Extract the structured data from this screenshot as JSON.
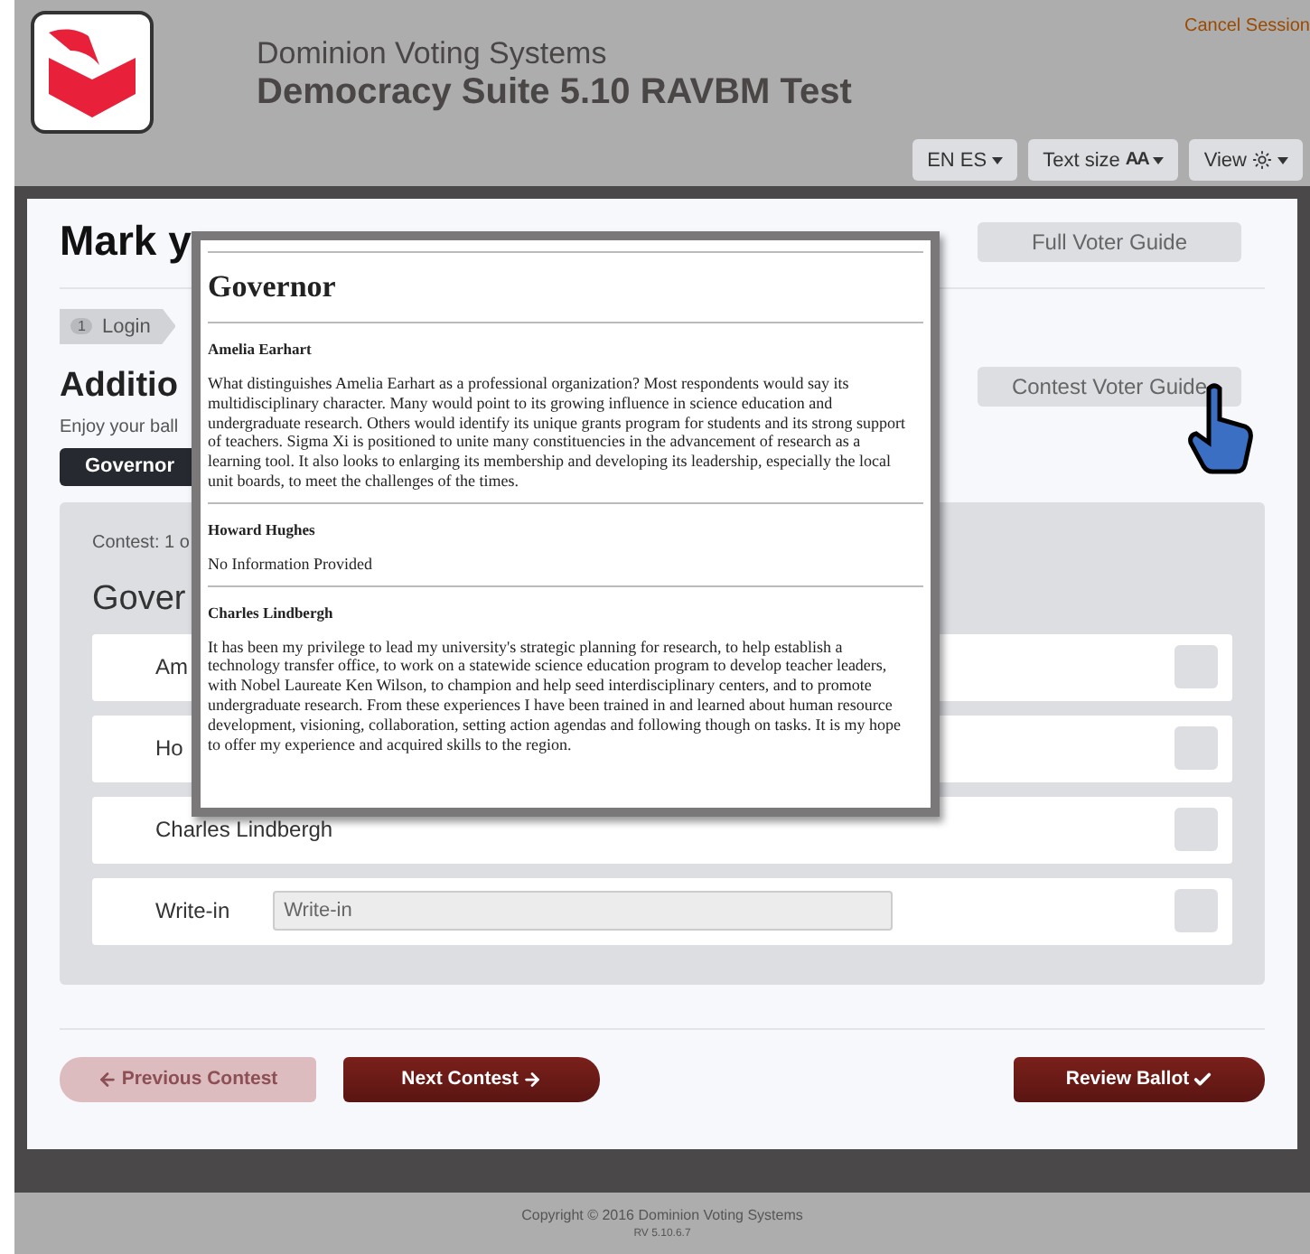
{
  "header": {
    "org": "Dominion Voting Systems",
    "title": "Democracy Suite 5.10 RAVBM Test",
    "cancel": "Cancel Session",
    "toolbar": [
      {
        "kind": "language",
        "label": "EN ES"
      },
      {
        "kind": "text_size",
        "label": "Text size",
        "glyph": "AA"
      },
      {
        "kind": "view",
        "label": "View"
      }
    ]
  },
  "page": {
    "heading": "Mark y",
    "full_guide": "Full Voter Guide",
    "steps": [
      {
        "number": "1",
        "label": "Login"
      }
    ],
    "section_heading": "Additio",
    "intro": "Enjoy your ball",
    "contest_guide": "Contest Voter Guide",
    "tabs": [
      {
        "label": "Governor",
        "selected": true
      }
    ],
    "contest": {
      "counter": "Contest: 1 o",
      "title": "Gover",
      "choices": [
        {
          "kind": "candidate",
          "name": "Am",
          "checked": false
        },
        {
          "kind": "candidate",
          "name": "Ho",
          "checked": false
        },
        {
          "kind": "candidate",
          "name": "Charles Lindbergh",
          "checked": false
        },
        {
          "kind": "write_in",
          "name": "Write-in",
          "placeholder": "Write-in",
          "checked": false
        }
      ]
    },
    "nav": [
      {
        "kind": "prev",
        "label": "Previous Contest",
        "disabled": true
      },
      {
        "kind": "next",
        "label": "Next Contest",
        "disabled": false
      },
      {
        "kind": "review",
        "label": "Review Ballot",
        "disabled": false
      }
    ]
  },
  "popup": {
    "title": "Governor",
    "entries": [
      {
        "name": "Amelia Earhart",
        "text": "What distinguishes Amelia Earhart as a professional organization? Most respondents would say its multidisciplinary character. Many would point to its growing influence in science education and undergraduate research. Others would identify its unique grants program for students and its strong support of teachers. Sigma Xi is positioned to unite many constituencies in the advancement of research as a learning tool. It also looks to enlarging its membership and developing its leadership, especially the local unit boards, to meet the challenges of the times."
      },
      {
        "name": "Howard Hughes",
        "text": "No Information Provided"
      },
      {
        "name": "Charles Lindbergh",
        "text": "It has been my privilege to lead my university's strategic planning for research, to help establish a technology transfer office, to work on a statewide science education program to develop teacher leaders, with Nobel Laureate Ken Wilson, to champion and help seed interdisciplinary centers, and to promote undergraduate research. From these experiences I have been trained in and learned about human resource development, visioning, collaboration, setting action agendas and following though on tasks. It is my hope to offer my experience and acquired skills to the region."
      }
    ]
  },
  "footer": {
    "copyright": "Copyright © 2016 Dominion Voting Systems",
    "version": "RV 5.10.6.7"
  }
}
